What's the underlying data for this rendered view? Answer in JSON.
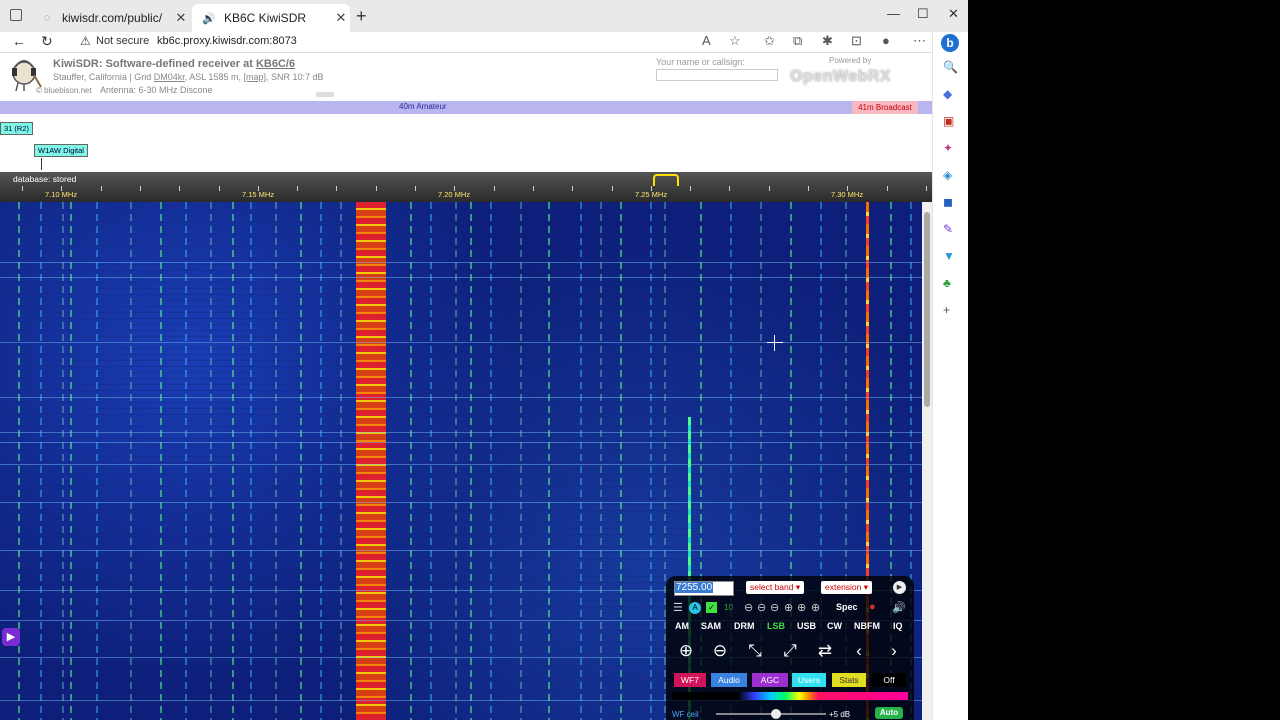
{
  "browser": {
    "tabs": [
      {
        "title": "kiwisdr.com/public/"
      },
      {
        "title": "KB6C KiwiSDR"
      }
    ],
    "new_tab": "+",
    "security_label": "Not secure",
    "url": "kb6c.proxy.kiwisdr.com:8073"
  },
  "kiwi": {
    "title_prefix": "KiwiSDR: Software-defined receiver at",
    "title_call": "KB6C/6",
    "location_pre": "Stauffer, California | Grid",
    "grid": "DM04kr",
    "location_mid": ", ASL 1585 m,",
    "map_link": "[map]",
    "snr": ", SNR 10:7 dB",
    "credit": "© bluebison.net",
    "antenna": "Antenna: 6-30 MHz Discone",
    "name_label": "Your name or callsign:",
    "powered_by": "Powered by",
    "openwebrx": "OpenWebRX"
  },
  "bands": {
    "band_40m": "40m Amateur",
    "band_41m": "41m Broadcast"
  },
  "labels": {
    "label1": "31 (R2)",
    "label2": "W1AW Digital"
  },
  "scale": {
    "database": "database: stored",
    "ticks": [
      "7.10 MHz",
      "7.15 MHz",
      "7.20 MHz",
      "7.25 MHz",
      "7.30 MHz"
    ]
  },
  "control": {
    "frequency": "7255.00",
    "band_select": "select band",
    "extension_select": "extension",
    "spec": "Spec",
    "modes": [
      "AM",
      "SAM",
      "DRM",
      "LSB",
      "USB",
      "CW",
      "NBFM",
      "IQ"
    ],
    "active_mode": "LSB",
    "panels": [
      "WF7",
      "Audio",
      "AGC",
      "Users",
      "Stats",
      "Off"
    ],
    "wf_ceil_label": "WF ceil",
    "wf_ceil_value": "+5 dB",
    "auto": "Auto"
  },
  "colors": {
    "waterfall_bg": "#0d1f7a",
    "band_40m": "#b9b6ef",
    "band_41m": "#f6b9c4",
    "label_bg": "#7ff7e7",
    "scale_text": "#ffe66e",
    "active_mode": "#3fe03f"
  }
}
